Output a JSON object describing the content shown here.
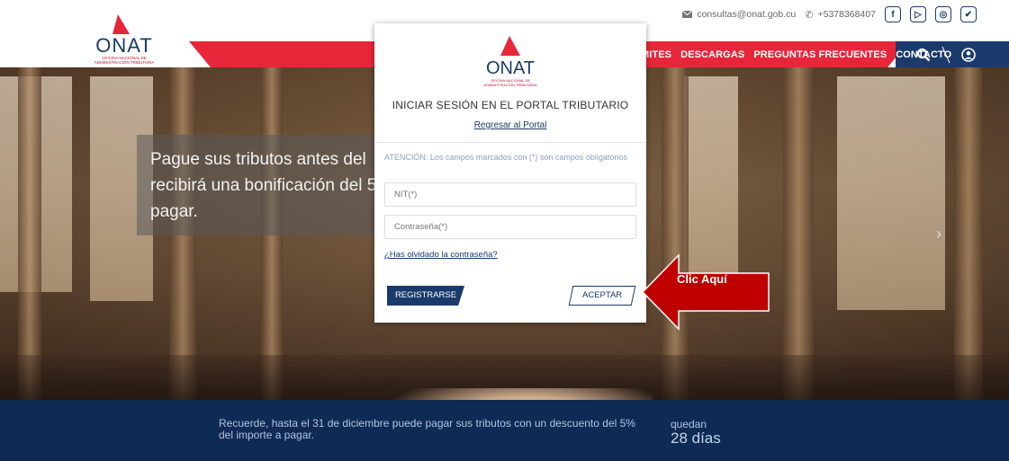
{
  "header": {
    "logo_word": "ONAT",
    "logo_sub": "OFICINA NACIONAL DE ADMINISTRACIÓN TRIBUTARIA",
    "email": "consultas@onat.gob.cu",
    "phone": "+5378368407",
    "social": [
      {
        "icon": "facebook-icon",
        "glyph": "f"
      },
      {
        "icon": "play-icon",
        "glyph": "▷"
      },
      {
        "icon": "instagram-icon",
        "glyph": "◎"
      },
      {
        "icon": "twitter-icon",
        "glyph": "✔"
      }
    ],
    "nav": [
      "MITES",
      "DESCARGAS",
      "PREGUNTAS FRECUENTES",
      "CONTACTO"
    ]
  },
  "hero": {
    "text": "Pague sus tributos antes del recibirá una bonificación del 5 pagar."
  },
  "banner": {
    "text": "Recuerde, hasta el 31 de diciembre puede pagar sus tributos con un descuento del 5% del importe a pagar.",
    "countdown_label": "quedan",
    "countdown_value": "28 días"
  },
  "modal": {
    "logo_word": "ONAT",
    "logo_sub": "OFICINA NACIONAL DE ADMINISTRACIÓN TRIBUTARIA",
    "title": "INICIAR SESIÓN EN EL PORTAL TRIBUTARIO",
    "back_link": "Regresar al Portal",
    "note": "ATENCIÓN: Los campos marcados con (*) son campos obligatorios",
    "nit_placeholder": "NIT(*)",
    "password_placeholder": "Contraseña(*)",
    "forgot_link": "¿Has olvidado la contraseña?",
    "register_label": "REGISTRARSE",
    "accept_label": "ACEPTAR"
  },
  "annotation": {
    "label": "Clic Aquí",
    "color": "#c00000"
  },
  "colors": {
    "brand_red": "#e8263a",
    "brand_navy": "#1a3a6b",
    "banner_bg": "#0f2a55"
  }
}
